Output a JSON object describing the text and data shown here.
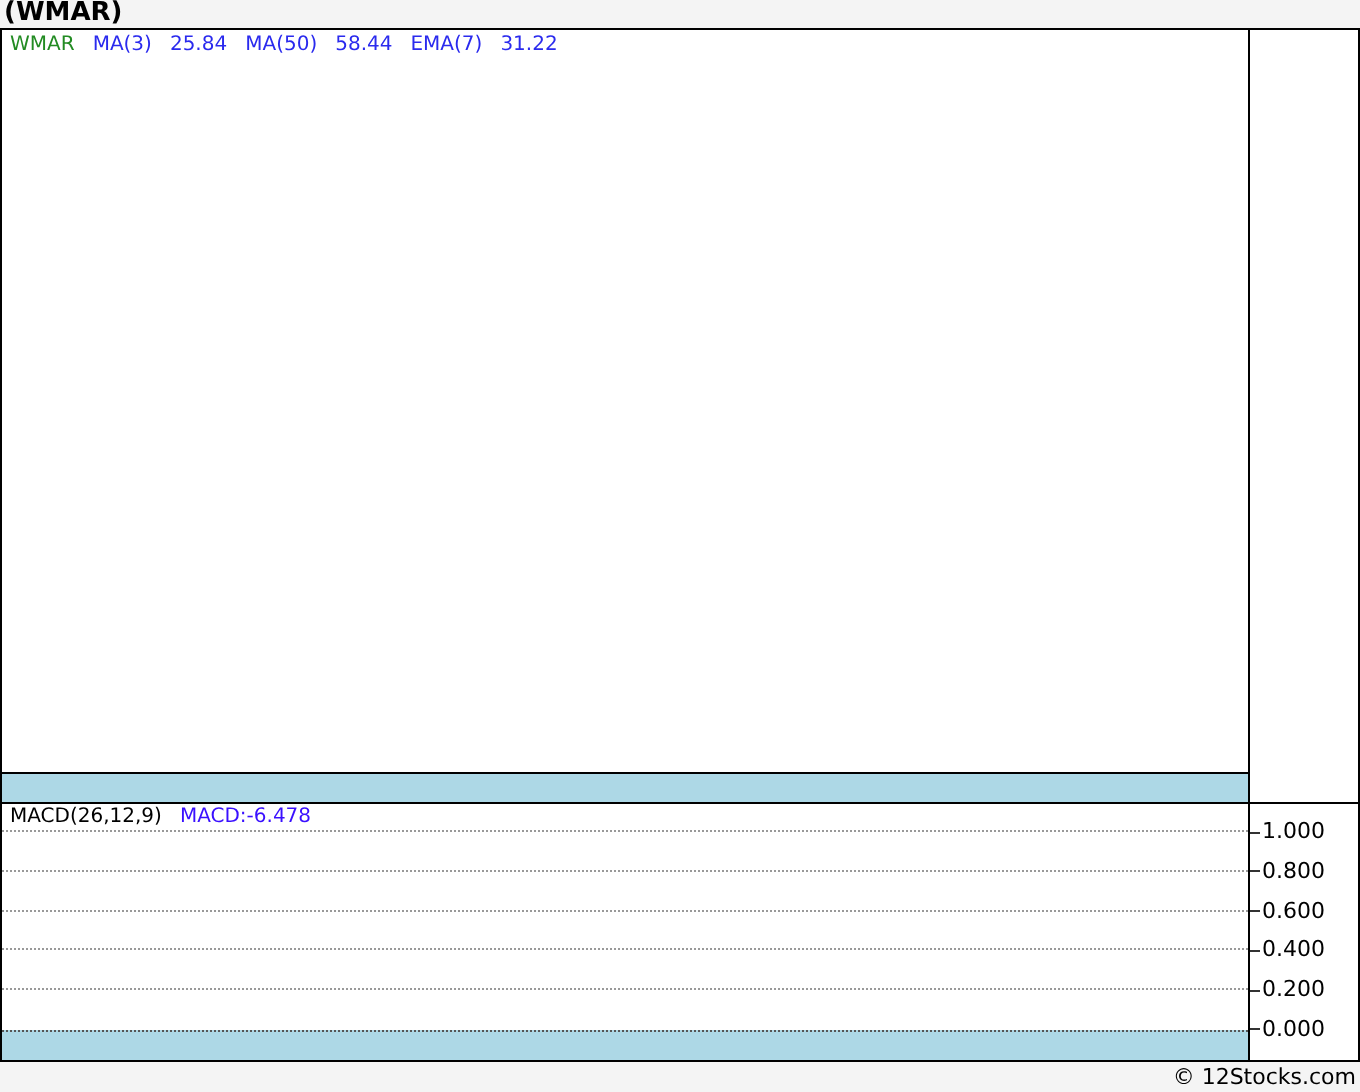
{
  "title": "(WMAR)",
  "price_panel": {
    "legend": [
      {
        "text": "WMAR",
        "color": "#228b22"
      },
      {
        "text": "MA(3)",
        "color": "#2a2aee"
      },
      {
        "text": "25.84",
        "color": "#2a2aee"
      },
      {
        "text": "MA(50)",
        "color": "#2a2aee"
      },
      {
        "text": "58.44",
        "color": "#2a2aee"
      },
      {
        "text": "EMA(7)",
        "color": "#2a2aee"
      },
      {
        "text": "31.22",
        "color": "#2a2aee"
      }
    ]
  },
  "macd_panel": {
    "legend": [
      {
        "text": "MACD(26,12,9)",
        "color": "#000000"
      },
      {
        "text": "MACD:-6.478",
        "color": "#3a10ff"
      }
    ],
    "axis_labels": [
      "1.000",
      "0.800",
      "0.600",
      "0.400",
      "0.200",
      "0.000"
    ]
  },
  "footer": "© 12Stocks.com"
}
